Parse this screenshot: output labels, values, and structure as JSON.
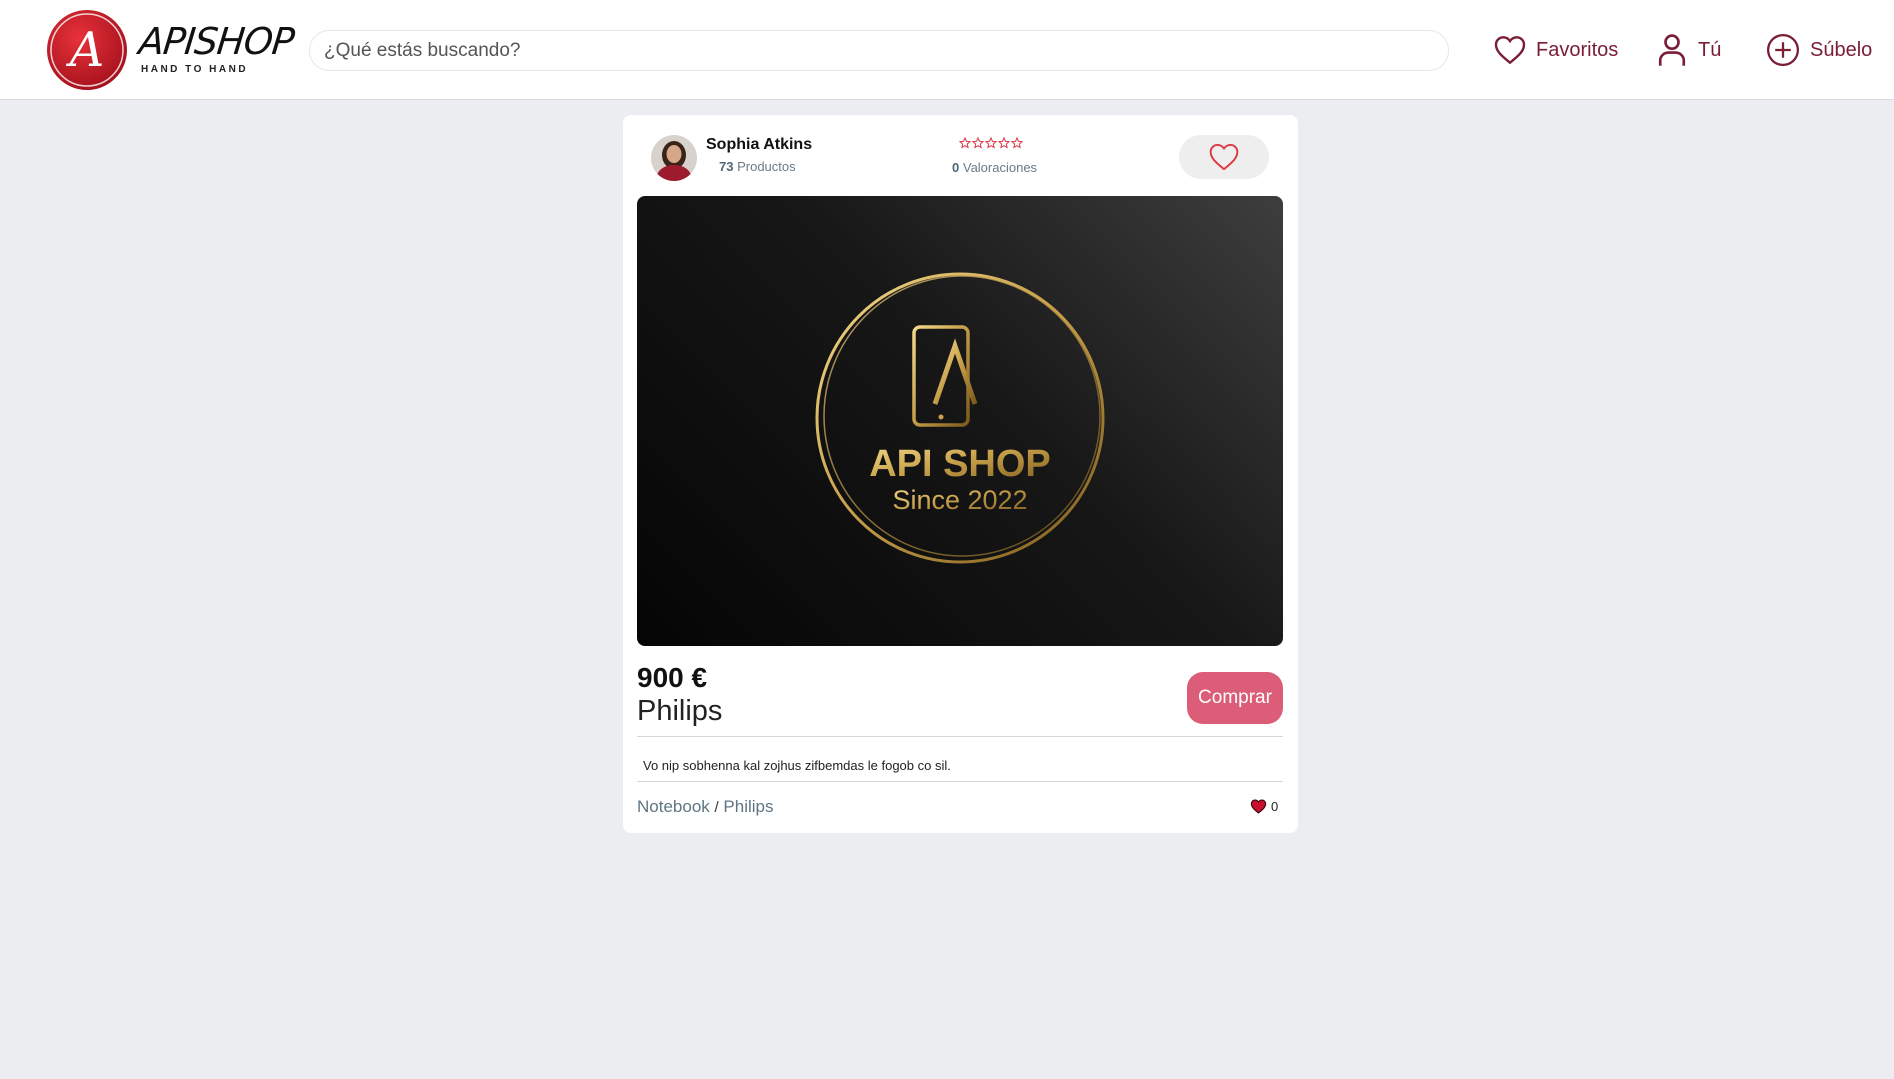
{
  "header": {
    "logo_word": "APISHOP",
    "logo_tagline": "HAND TO HAND",
    "logo_letter": "A",
    "search_placeholder": "¿Qué estás buscando?",
    "nav": {
      "favorites": "Favoritos",
      "you": "Tú",
      "upload": "Súbelo"
    }
  },
  "product": {
    "seller": {
      "name": "Sophia Atkins",
      "product_count": "73",
      "product_label": "Productos"
    },
    "rating": {
      "stars_filled": 0,
      "stars_total": 5,
      "count": "0",
      "label": "Valoraciones"
    },
    "image": {
      "brand_text": "API SHOP",
      "since_text": "Since 2022"
    },
    "price": "900 €",
    "title": "Philips",
    "buy_label": "Comprar",
    "description": "Vo nip sobhenna kal zojhus zifbemdas le fogob co sil.",
    "category": "Notebook",
    "separator": "/",
    "brand": "Philips",
    "likes": "0"
  },
  "colors": {
    "accent": "#7a1d35",
    "buy_button": "#dc5d78",
    "background": "#ebedf0",
    "gold": "#c9a24b"
  }
}
